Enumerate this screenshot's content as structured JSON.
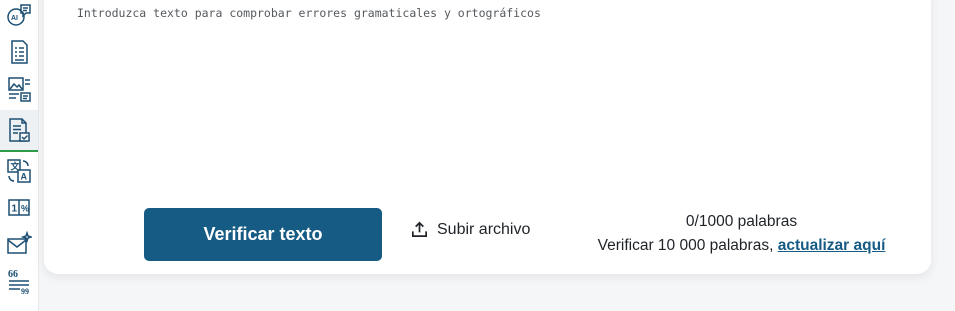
{
  "sidebar": {
    "items": [
      {
        "name": "ai-chat-icon"
      },
      {
        "name": "document-list-icon"
      },
      {
        "name": "image-text-icon"
      },
      {
        "name": "document-check-icon",
        "active": true
      },
      {
        "name": "translate-icon"
      },
      {
        "name": "number-icon"
      },
      {
        "name": "email-sparkle-icon"
      },
      {
        "name": "quote-icon"
      }
    ]
  },
  "editor": {
    "placeholder": "Introduzca texto para comprobar errores gramaticales y ortográficos"
  },
  "actions": {
    "verify_label": "Verificar texto",
    "upload_label": "Subir archivo"
  },
  "word_count": {
    "current": "0/1000 palabras",
    "upgrade_prefix": "Verificar 10 000 palabras,",
    "upgrade_link": "actualizar aquí"
  },
  "colors": {
    "primary": "#165b84",
    "active_indicator": "#2e9b4a",
    "icon": "#1d4f73"
  }
}
